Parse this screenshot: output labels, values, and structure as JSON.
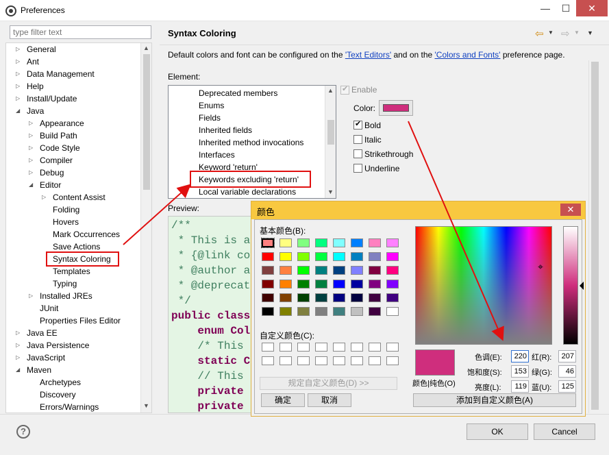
{
  "window": {
    "title": "Preferences",
    "minimize": "—",
    "maximize": "☐",
    "close": "✕"
  },
  "filter": {
    "placeholder": "type filter text"
  },
  "tree": [
    {
      "label": "General",
      "level": 0,
      "twisty": "▷"
    },
    {
      "label": "Ant",
      "level": 0,
      "twisty": "▷"
    },
    {
      "label": "Data Management",
      "level": 0,
      "twisty": "▷"
    },
    {
      "label": "Help",
      "level": 0,
      "twisty": "▷"
    },
    {
      "label": "Install/Update",
      "level": 0,
      "twisty": "▷"
    },
    {
      "label": "Java",
      "level": 0,
      "twisty": "◢"
    },
    {
      "label": "Appearance",
      "level": 1,
      "twisty": "▷"
    },
    {
      "label": "Build Path",
      "level": 1,
      "twisty": "▷"
    },
    {
      "label": "Code Style",
      "level": 1,
      "twisty": "▷"
    },
    {
      "label": "Compiler",
      "level": 1,
      "twisty": "▷"
    },
    {
      "label": "Debug",
      "level": 1,
      "twisty": "▷"
    },
    {
      "label": "Editor",
      "level": 1,
      "twisty": "◢"
    },
    {
      "label": "Content Assist",
      "level": 2,
      "twisty": "▷"
    },
    {
      "label": "Folding",
      "level": 2,
      "twisty": ""
    },
    {
      "label": "Hovers",
      "level": 2,
      "twisty": ""
    },
    {
      "label": "Mark Occurrences",
      "level": 2,
      "twisty": ""
    },
    {
      "label": "Save Actions",
      "level": 2,
      "twisty": ""
    },
    {
      "label": "Syntax Coloring",
      "level": 2,
      "twisty": "",
      "selected": true
    },
    {
      "label": "Templates",
      "level": 2,
      "twisty": ""
    },
    {
      "label": "Typing",
      "level": 2,
      "twisty": ""
    },
    {
      "label": "Installed JREs",
      "level": 1,
      "twisty": "▷"
    },
    {
      "label": "JUnit",
      "level": 1,
      "twisty": ""
    },
    {
      "label": "Properties Files Editor",
      "level": 1,
      "twisty": ""
    },
    {
      "label": "Java EE",
      "level": 0,
      "twisty": "▷"
    },
    {
      "label": "Java Persistence",
      "level": 0,
      "twisty": "▷"
    },
    {
      "label": "JavaScript",
      "level": 0,
      "twisty": "▷"
    },
    {
      "label": "Maven",
      "level": 0,
      "twisty": "◢"
    },
    {
      "label": "Archetypes",
      "level": 1,
      "twisty": ""
    },
    {
      "label": "Discovery",
      "level": 1,
      "twisty": ""
    },
    {
      "label": "Errors/Warnings",
      "level": 1,
      "twisty": ""
    }
  ],
  "page": {
    "title": "Syntax Coloring",
    "desc_prefix": "Default colors and font can be configured on the ",
    "link1": "'Text Editors'",
    "desc_mid": " and on the ",
    "link2": "'Colors and Fonts'",
    "desc_suffix": " preference page.",
    "element_label": "Element:",
    "elements": [
      "Deprecated members",
      "Enums",
      "Fields",
      "Inherited fields",
      "Inherited method invocations",
      "Interfaces",
      "Keyword 'return'",
      "Keywords excluding 'return'",
      "Local variable declarations"
    ],
    "selected_element": "Keywords excluding 'return'",
    "enable_label": "Enable",
    "color_label": "Color:",
    "bold_label": "Bold",
    "italic_label": "Italic",
    "strike_label": "Strikethrough",
    "underline_label": "Underline",
    "bold_checked": true,
    "preview_label": "Preview:",
    "preview_lines": [
      {
        "text": "/**",
        "style": "c-cm"
      },
      {
        "text": " * This is a",
        "style": "c-cm"
      },
      {
        "text": " * {@link co",
        "style": "c-cm"
      },
      {
        "text": " * @author a",
        "style": "c-cm"
      },
      {
        "text": " * @deprecat",
        "style": "c-cm"
      },
      {
        "text": " */",
        "style": "c-cm"
      },
      {
        "text": "public class",
        "style": "c-kw"
      },
      {
        "text": "    enum Col",
        "style": "c-kw"
      },
      {
        "text": "    /* This",
        "style": "c-cm"
      },
      {
        "text": "    static C",
        "style": "c-kw"
      },
      {
        "text": "    // This",
        "style": "c-cm"
      },
      {
        "text": "    private",
        "style": "c-kw"
      },
      {
        "text": "    private",
        "style": "c-kw"
      }
    ],
    "nav_back": "⇦",
    "nav_forward": "⇨"
  },
  "buttons": {
    "ok": "OK",
    "cancel": "Cancel"
  },
  "color_dialog": {
    "title": "颜色",
    "close": "✕",
    "basic_label": "基本颜色(B):",
    "custom_label": "自定义颜色(C):",
    "define_custom": "规定自定义颜色(D) >>",
    "ok": "确定",
    "cancel": "取消",
    "add_custom": "添加到自定义颜色(A)",
    "sample_label": "颜色|纯色(O)",
    "hue_label": "色调(E):",
    "sat_label": "饱和度(S):",
    "lum_label": "亮度(L):",
    "red_label": "红(R):",
    "green_label": "绿(G):",
    "blue_label": "蓝(U):",
    "hue": "220",
    "sat": "153",
    "lum": "119",
    "red": "207",
    "green": "46",
    "blue": "125",
    "current_color": "#cf2e7d",
    "basic_colors": [
      [
        "#ff8080",
        "#ffff80",
        "#80ff80",
        "#00ff80",
        "#80ffff",
        "#0080ff",
        "#ff80c0",
        "#ff80ff"
      ],
      [
        "#ff0000",
        "#ffff00",
        "#80ff00",
        "#00ff40",
        "#00ffff",
        "#0080c0",
        "#8080c0",
        "#ff00ff"
      ],
      [
        "#804040",
        "#ff8040",
        "#00ff00",
        "#008080",
        "#004080",
        "#8080ff",
        "#800040",
        "#ff0080"
      ],
      [
        "#800000",
        "#ff8000",
        "#008000",
        "#008040",
        "#0000ff",
        "#0000a0",
        "#800080",
        "#8000ff"
      ],
      [
        "#400000",
        "#804000",
        "#004000",
        "#004040",
        "#000080",
        "#000040",
        "#400040",
        "#400080"
      ],
      [
        "#000000",
        "#808000",
        "#808040",
        "#808080",
        "#408080",
        "#c0c0c0",
        "#400040",
        "#ffffff"
      ]
    ]
  },
  "colors": {
    "accent_magenta": "#cf2e7d",
    "highlight_red": "#e01010",
    "dialog_gold": "#f8c840"
  }
}
